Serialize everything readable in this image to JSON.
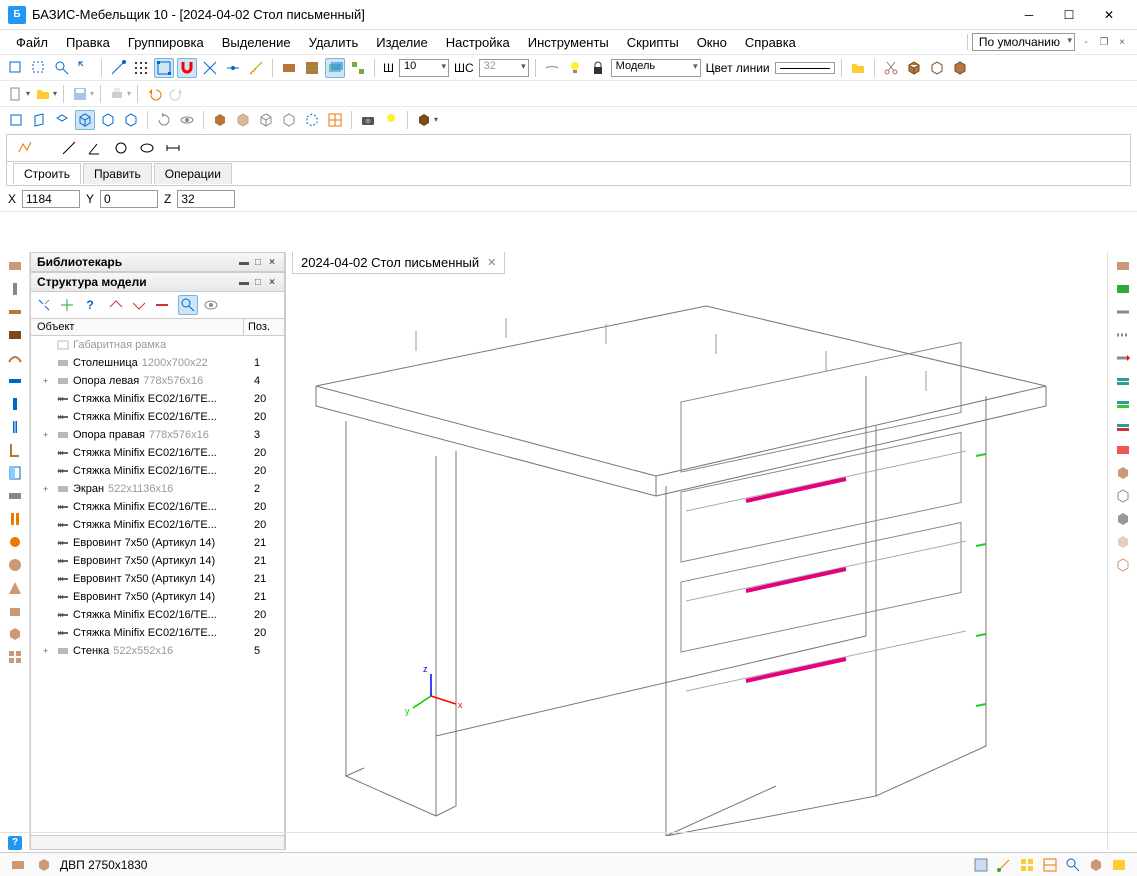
{
  "window": {
    "title": "БАЗИС-Мебельщик 10 - [2024-04-02 Стол письменный]"
  },
  "menu": {
    "items": [
      "Файл",
      "Правка",
      "Группировка",
      "Выделение",
      "Удалить",
      "Изделие",
      "Настройка",
      "Инструменты",
      "Скрипты",
      "Окно",
      "Справка"
    ],
    "preset": "По умолчанию"
  },
  "toolbar1": {
    "w_label": "Ш",
    "width_value": "10",
    "ws_label": "ШС",
    "ws_value": "32",
    "mode_label": "Модель",
    "line_color_label": "Цвет линии"
  },
  "tabs": {
    "build": "Строить",
    "edit": "Править",
    "ops": "Операции"
  },
  "coords": {
    "x_label": "X",
    "x": "1184",
    "y_label": "Y",
    "y": "0",
    "z_label": "Z",
    "z": "32"
  },
  "panels": {
    "librarian": "Библиотекарь",
    "structure": "Структура модели",
    "col_object": "Объект",
    "col_pos": "Поз."
  },
  "tree": [
    {
      "twisty": "",
      "icon": "box-ghost",
      "name": "Габаритная рамка",
      "dims": "",
      "pos": "",
      "ghost": true
    },
    {
      "twisty": "",
      "icon": "panel",
      "name": "Столешница",
      "dims": "1200x700x22",
      "pos": "1"
    },
    {
      "twisty": "+",
      "icon": "panel",
      "name": "Опора левая",
      "dims": "778x576x16",
      "pos": "4"
    },
    {
      "twisty": "",
      "icon": "fastener",
      "name": "Стяжка Minifix EC02/16/TE...",
      "dims": "",
      "pos": "20"
    },
    {
      "twisty": "",
      "icon": "fastener",
      "name": "Стяжка Minifix EC02/16/TE...",
      "dims": "",
      "pos": "20"
    },
    {
      "twisty": "+",
      "icon": "panel",
      "name": "Опора правая",
      "dims": "778x576x16",
      "pos": "3"
    },
    {
      "twisty": "",
      "icon": "fastener",
      "name": "Стяжка Minifix EC02/16/TE...",
      "dims": "",
      "pos": "20"
    },
    {
      "twisty": "",
      "icon": "fastener",
      "name": "Стяжка Minifix EC02/16/TE...",
      "dims": "",
      "pos": "20"
    },
    {
      "twisty": "+",
      "icon": "panel",
      "name": "Экран",
      "dims": "522x1136x16",
      "pos": "2"
    },
    {
      "twisty": "",
      "icon": "fastener",
      "name": "Стяжка Minifix EC02/16/TE...",
      "dims": "",
      "pos": "20"
    },
    {
      "twisty": "",
      "icon": "fastener",
      "name": "Стяжка Minifix EC02/16/TE...",
      "dims": "",
      "pos": "20"
    },
    {
      "twisty": "",
      "icon": "fastener",
      "name": "Евровинт 7x50 (Артикул 14)",
      "dims": "",
      "pos": "21"
    },
    {
      "twisty": "",
      "icon": "fastener",
      "name": "Евровинт 7x50 (Артикул 14)",
      "dims": "",
      "pos": "21"
    },
    {
      "twisty": "",
      "icon": "fastener",
      "name": "Евровинт 7x50 (Артикул 14)",
      "dims": "",
      "pos": "21"
    },
    {
      "twisty": "",
      "icon": "fastener",
      "name": "Евровинт 7x50 (Артикул 14)",
      "dims": "",
      "pos": "21"
    },
    {
      "twisty": "",
      "icon": "fastener",
      "name": "Стяжка Minifix EC02/16/TE...",
      "dims": "",
      "pos": "20"
    },
    {
      "twisty": "",
      "icon": "fastener",
      "name": "Стяжка Minifix EC02/16/TE...",
      "dims": "",
      "pos": "20"
    },
    {
      "twisty": "+",
      "icon": "panel",
      "name": "Стенка",
      "dims": "522x552x16",
      "pos": "5"
    }
  ],
  "doc_tab": {
    "title": "2024-04-02 Стол письменный"
  },
  "status": {
    "material": "ДВП 2750x1830"
  }
}
